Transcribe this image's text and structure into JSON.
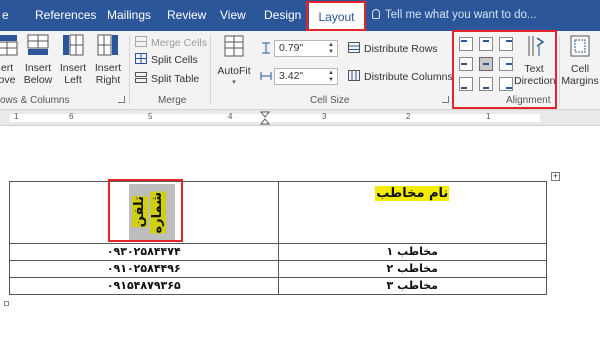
{
  "tabs": {
    "file_partial": "e",
    "references": "References",
    "mailings": "Mailings",
    "review": "Review",
    "view": "View",
    "design": "Design",
    "layout": "Layout",
    "tell_me": "Tell me what you want to do..."
  },
  "ribbon": {
    "rows_columns": {
      "insert_above": [
        "ert",
        "ove"
      ],
      "insert_below": [
        "Insert",
        "Below"
      ],
      "insert_left": [
        "Insert",
        "Left"
      ],
      "insert_right": [
        "Insert",
        "Right"
      ],
      "group_label": "ows & Columns"
    },
    "merge": {
      "merge_cells": "Merge Cells",
      "split_cells": "Split Cells",
      "split_table": "Split Table",
      "group_label": "Merge"
    },
    "cell_size": {
      "autofit": "AutoFit",
      "height_value": "0.79\"",
      "width_value": "3.42\"",
      "distribute_rows": "Distribute Rows",
      "distribute_columns": "Distribute Columns",
      "group_label": "Cell Size"
    },
    "alignment": {
      "text_direction": [
        "Text",
        "Direction"
      ],
      "group_label": "Alignment",
      "selected_cell_index": 4
    },
    "cell_margins": [
      "Cell",
      "Margins"
    ]
  },
  "ruler": {
    "numbers": [
      "1",
      "6",
      "5",
      "4",
      "3",
      "2",
      "1"
    ]
  },
  "table": {
    "header_name": "نام مخاطب",
    "header_phone_line1": "شماره",
    "header_phone_line2": "تلفن",
    "rows": [
      {
        "phone": "۰۹۳۰۲۵۸۴۴۷۴",
        "name": "مخاطب ۱"
      },
      {
        "phone": "۰۹۱۰۲۵۸۴۴۹۶",
        "name": "مخاطب ۲"
      },
      {
        "phone": "۰۹۱۵۴۸۷۹۳۶۵",
        "name": "مخاطب ۳"
      }
    ]
  },
  "colors": {
    "title_bar": "#2b579a",
    "highlight": "#f2ec00",
    "callout": "#e3242b",
    "cell_shading": "#bdbdbd"
  }
}
